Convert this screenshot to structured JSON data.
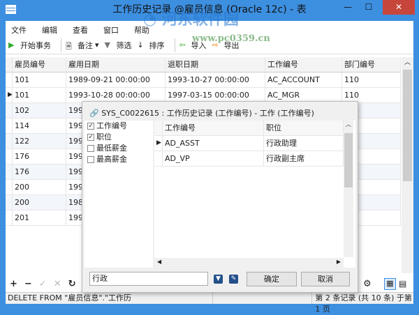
{
  "window": {
    "title": "工作历史记录 @雇员信息 (Oracle 12c) - 表",
    "min": "—",
    "max": "☐",
    "close": "✕"
  },
  "watermark": {
    "name": "河东软件园",
    "url": "www.pc0359.cn"
  },
  "menu": [
    "文件",
    "编辑",
    "查看",
    "窗口",
    "帮助"
  ],
  "toolbar": {
    "begin": "开始事务",
    "note": "备注",
    "filter": "筛选",
    "sort": "排序",
    "import": "导入",
    "export": "导出"
  },
  "grid": {
    "headers": [
      "雇员编号",
      "雇用日期",
      "退职日期",
      "工作编号",
      "部门编号"
    ],
    "rows": [
      [
        "101",
        "1989-09-21 00:00:00",
        "1993-10-27 00:00:00",
        "AC_ACCOUNT",
        "110"
      ],
      [
        "101",
        "1993-10-28 00:00:00",
        "1997-03-15 00:00:00",
        "AC_MGR",
        "110"
      ],
      [
        "102",
        "199",
        "",
        "",
        ""
      ],
      [
        "114",
        "199",
        "",
        "",
        ""
      ],
      [
        "122",
        "199",
        "",
        "",
        ""
      ],
      [
        "176",
        "199",
        "",
        "",
        ""
      ],
      [
        "176",
        "199",
        "",
        "",
        ""
      ],
      [
        "200",
        "199",
        "",
        "",
        ""
      ],
      [
        "200",
        "198",
        "",
        "",
        ""
      ],
      [
        "201",
        "199",
        "",
        "",
        ""
      ]
    ]
  },
  "popup": {
    "title": "SYS_C0022615 : 工作历史记录 (工作编号) - 工作 (工作编号)",
    "fields": [
      {
        "label": "工作编号",
        "checked": true
      },
      {
        "label": "职位",
        "checked": true
      },
      {
        "label": "最低薪金",
        "checked": false
      },
      {
        "label": "最高薪金",
        "checked": false
      }
    ],
    "headers": [
      "工作编号",
      "职位"
    ],
    "rows": [
      [
        "AD_ASST",
        "行政助理"
      ],
      [
        "AD_VP",
        "行政副主席"
      ]
    ],
    "search": "行政",
    "ok": "确定",
    "cancel": "取消"
  },
  "status": {
    "sql": "DELETE FROM \"雇员信息\".\"工作历",
    "record": "第 2 条记录 (共 10 条) 于第 1 页"
  }
}
